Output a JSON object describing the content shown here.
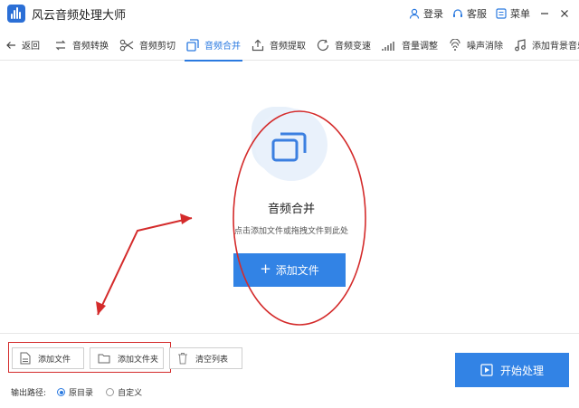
{
  "app": {
    "title": "风云音频处理大师"
  },
  "title_actions": {
    "login": "登录",
    "service": "客服",
    "menu": "菜单"
  },
  "toolbar": {
    "back": "返回",
    "items": [
      "音频转换",
      "音频剪切",
      "音频合并",
      "音频提取",
      "音频变速",
      "音量调整",
      "噪声消除",
      "添加背景音乐"
    ],
    "active_index": 2
  },
  "hero": {
    "title": "音频合并",
    "hint": "点击添加文件或拖拽文件到此处",
    "add_button": "添加文件"
  },
  "bottom": {
    "add_file": "添加文件",
    "add_folder": "添加文件夹",
    "clear_list": "清空列表",
    "output_label": "输出路径:",
    "option_original": "原目录",
    "option_custom": "自定义",
    "start_button": "开始处理"
  },
  "colors": {
    "accent": "#3283e5",
    "annotation": "#d42b2b"
  }
}
